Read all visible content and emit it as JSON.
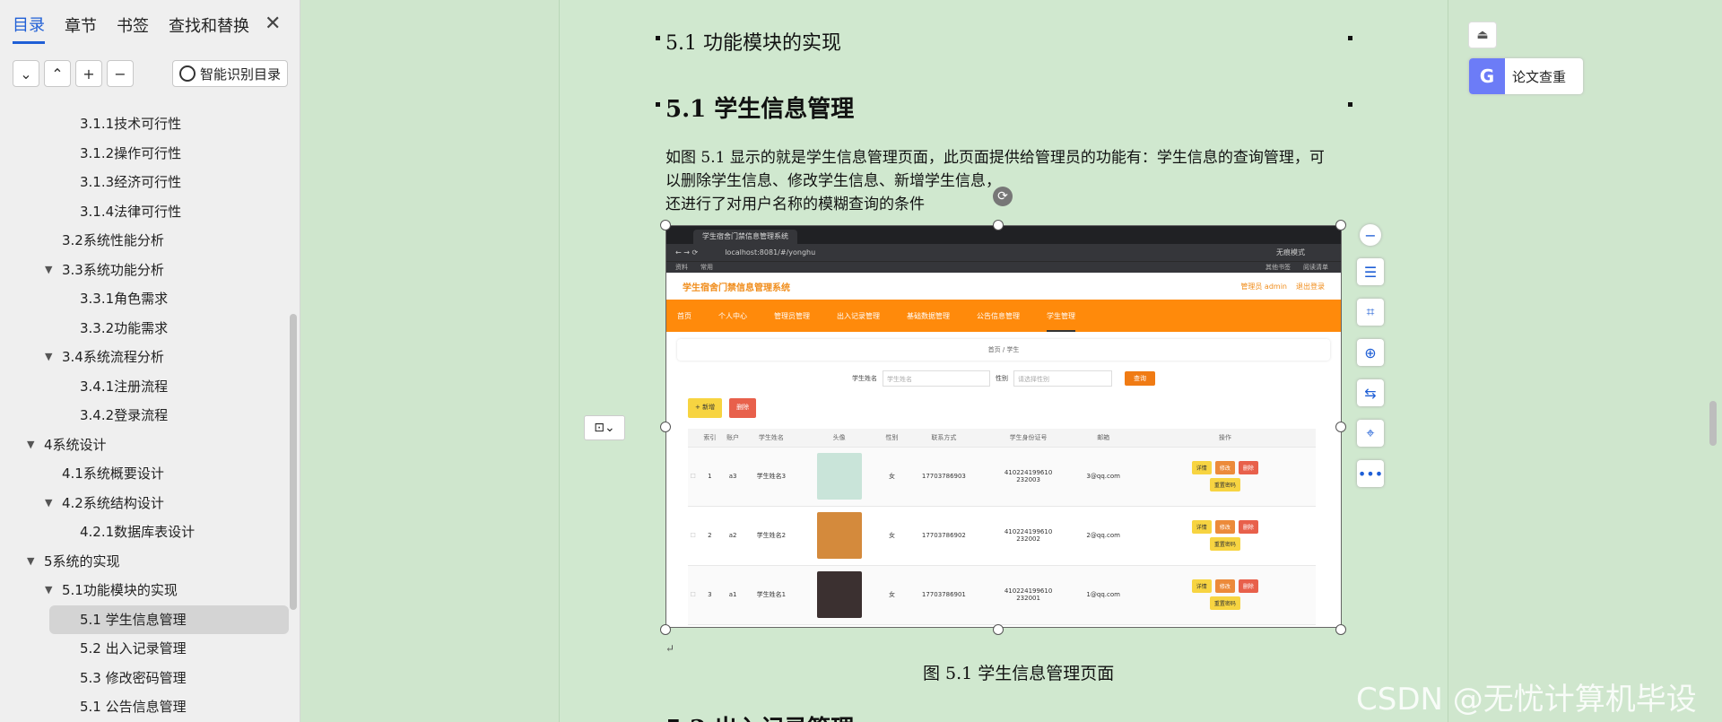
{
  "nav": {
    "tabs": [
      "目录",
      "章节",
      "书签",
      "查找和替换"
    ],
    "close_label": "✕",
    "tools": [
      "⌄",
      "⌃",
      "+",
      "−"
    ],
    "smart_toc": "智能识别目录",
    "toc": [
      {
        "label": "3.1.1技术可行性",
        "level": 3
      },
      {
        "label": "3.1.2操作可行性",
        "level": 3
      },
      {
        "label": "3.1.3经济可行性",
        "level": 3
      },
      {
        "label": "3.1.4法律可行性",
        "level": 3
      },
      {
        "label": "3.2系统性能分析",
        "level": 2
      },
      {
        "label": "3.3系统功能分析",
        "level": 2,
        "expanded": true
      },
      {
        "label": "3.3.1角色需求",
        "level": 3
      },
      {
        "label": "3.3.2功能需求",
        "level": 3
      },
      {
        "label": "3.4系统流程分析",
        "level": 2,
        "expanded": true
      },
      {
        "label": "3.4.1注册流程",
        "level": 3
      },
      {
        "label": "3.4.2登录流程",
        "level": 3
      },
      {
        "label": "4系统设计",
        "level": 1,
        "expanded": true
      },
      {
        "label": "4.1系统概要设计",
        "level": 2
      },
      {
        "label": "4.2系统结构设计",
        "level": 2,
        "expanded": true
      },
      {
        "label": "4.2.1数据库表设计",
        "level": 3
      },
      {
        "label": "5系统的实现",
        "level": 1,
        "expanded": true
      },
      {
        "label": "5.1功能模块的实现",
        "level": 2,
        "expanded": true
      },
      {
        "label": "5.1 学生信息管理",
        "level": 3,
        "selected": true
      },
      {
        "label": "5.2  出入记录管理",
        "level": 3
      },
      {
        "label": "5.3 修改密码管理",
        "level": 3
      },
      {
        "label": "5.1 公告信息管理",
        "level": 3
      }
    ]
  },
  "doc": {
    "heading3": "5.1 功能模块的实现",
    "heading2": "5.1 学生信息管理",
    "paragraph_line1": "如图 5.1 显示的就是学生信息管理页面，此页面提供给管理员的功能有：学生信息的查询管理，可",
    "paragraph_line2": "以删除学生信息、修改学生信息、新增学生信息，",
    "paragraph_line3": "还进行了对用户名称的模糊查询的条件",
    "caption": "图 5.1 学生信息管理页面",
    "next_heading": "5.2 出入记录管理"
  },
  "shot": {
    "tab_title": "学生宿舍门禁信息管理系统",
    "url": "localhost:8081/#/yonghu",
    "private_mode": "无痕模式",
    "bookmarks": [
      "资料",
      "常用",
      "其他书签",
      "阅读清单"
    ],
    "app_title": "学生宿舍门禁信息管理系统",
    "user": "管理员 admin",
    "logout": "退出登录",
    "menu": [
      "首页",
      "个人中心",
      "管理员管理",
      "出入记录管理",
      "基础数据管理",
      "公告信息管理",
      "学生管理"
    ],
    "crumb": "首页 / 学生",
    "search_label": "学生姓名",
    "search_placeholder": "学生姓名",
    "gender_label": "性别",
    "gender_placeholder": "请选择性别",
    "search_btn": "查询",
    "add_btn": "+ 新增",
    "del_btn": "删除",
    "columns": [
      "",
      "索引",
      "账户",
      "学生姓名",
      "头像",
      "性别",
      "联系方式",
      "学生身份证号",
      "邮箱",
      "操作"
    ],
    "rows": [
      {
        "idx": "1",
        "account": "a3",
        "name": "学生姓名3",
        "gender": "女",
        "phone": "17703786903",
        "id_line1": "410224199610",
        "id_line2": "232003",
        "email": "3@qq.com"
      },
      {
        "idx": "2",
        "account": "a2",
        "name": "学生姓名2",
        "gender": "女",
        "phone": "17703786902",
        "id_line1": "410224199610",
        "id_line2": "232002",
        "email": "2@qq.com"
      },
      {
        "idx": "3",
        "account": "a1",
        "name": "学生姓名1",
        "gender": "女",
        "phone": "17703786901",
        "id_line1": "410224199610",
        "id_line2": "232001",
        "email": "1@qq.com"
      }
    ],
    "op_detail": "详情",
    "op_edit": "修改",
    "op_delete": "删除",
    "op_reset": "重置密码"
  },
  "right": {
    "paper_check": "论文查重"
  },
  "watermark": "CSDN @无忧计算机毕设"
}
